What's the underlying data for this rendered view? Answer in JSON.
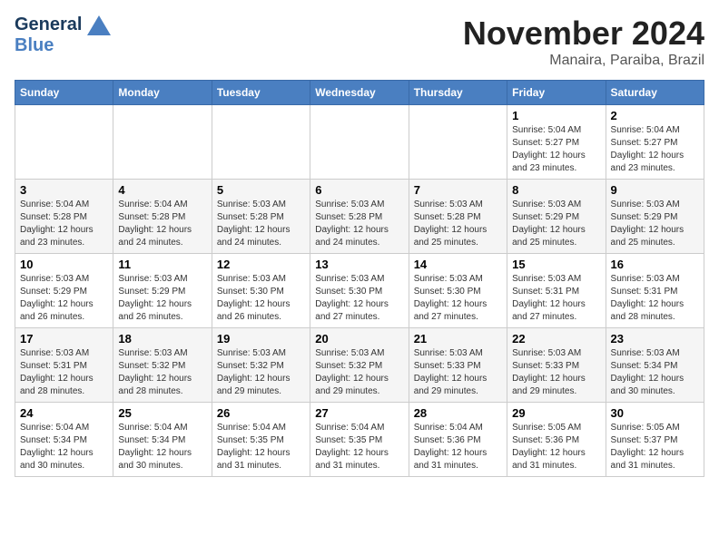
{
  "header": {
    "logo_line1": "General",
    "logo_line2": "Blue",
    "month_title": "November 2024",
    "location": "Manaira, Paraiba, Brazil"
  },
  "weekdays": [
    "Sunday",
    "Monday",
    "Tuesday",
    "Wednesday",
    "Thursday",
    "Friday",
    "Saturday"
  ],
  "weeks": [
    [
      {
        "day": "",
        "info": ""
      },
      {
        "day": "",
        "info": ""
      },
      {
        "day": "",
        "info": ""
      },
      {
        "day": "",
        "info": ""
      },
      {
        "day": "",
        "info": ""
      },
      {
        "day": "1",
        "info": "Sunrise: 5:04 AM\nSunset: 5:27 PM\nDaylight: 12 hours and 23 minutes."
      },
      {
        "day": "2",
        "info": "Sunrise: 5:04 AM\nSunset: 5:27 PM\nDaylight: 12 hours and 23 minutes."
      }
    ],
    [
      {
        "day": "3",
        "info": "Sunrise: 5:04 AM\nSunset: 5:28 PM\nDaylight: 12 hours and 23 minutes."
      },
      {
        "day": "4",
        "info": "Sunrise: 5:04 AM\nSunset: 5:28 PM\nDaylight: 12 hours and 24 minutes."
      },
      {
        "day": "5",
        "info": "Sunrise: 5:03 AM\nSunset: 5:28 PM\nDaylight: 12 hours and 24 minutes."
      },
      {
        "day": "6",
        "info": "Sunrise: 5:03 AM\nSunset: 5:28 PM\nDaylight: 12 hours and 24 minutes."
      },
      {
        "day": "7",
        "info": "Sunrise: 5:03 AM\nSunset: 5:28 PM\nDaylight: 12 hours and 25 minutes."
      },
      {
        "day": "8",
        "info": "Sunrise: 5:03 AM\nSunset: 5:29 PM\nDaylight: 12 hours and 25 minutes."
      },
      {
        "day": "9",
        "info": "Sunrise: 5:03 AM\nSunset: 5:29 PM\nDaylight: 12 hours and 25 minutes."
      }
    ],
    [
      {
        "day": "10",
        "info": "Sunrise: 5:03 AM\nSunset: 5:29 PM\nDaylight: 12 hours and 26 minutes."
      },
      {
        "day": "11",
        "info": "Sunrise: 5:03 AM\nSunset: 5:29 PM\nDaylight: 12 hours and 26 minutes."
      },
      {
        "day": "12",
        "info": "Sunrise: 5:03 AM\nSunset: 5:30 PM\nDaylight: 12 hours and 26 minutes."
      },
      {
        "day": "13",
        "info": "Sunrise: 5:03 AM\nSunset: 5:30 PM\nDaylight: 12 hours and 27 minutes."
      },
      {
        "day": "14",
        "info": "Sunrise: 5:03 AM\nSunset: 5:30 PM\nDaylight: 12 hours and 27 minutes."
      },
      {
        "day": "15",
        "info": "Sunrise: 5:03 AM\nSunset: 5:31 PM\nDaylight: 12 hours and 27 minutes."
      },
      {
        "day": "16",
        "info": "Sunrise: 5:03 AM\nSunset: 5:31 PM\nDaylight: 12 hours and 28 minutes."
      }
    ],
    [
      {
        "day": "17",
        "info": "Sunrise: 5:03 AM\nSunset: 5:31 PM\nDaylight: 12 hours and 28 minutes."
      },
      {
        "day": "18",
        "info": "Sunrise: 5:03 AM\nSunset: 5:32 PM\nDaylight: 12 hours and 28 minutes."
      },
      {
        "day": "19",
        "info": "Sunrise: 5:03 AM\nSunset: 5:32 PM\nDaylight: 12 hours and 29 minutes."
      },
      {
        "day": "20",
        "info": "Sunrise: 5:03 AM\nSunset: 5:32 PM\nDaylight: 12 hours and 29 minutes."
      },
      {
        "day": "21",
        "info": "Sunrise: 5:03 AM\nSunset: 5:33 PM\nDaylight: 12 hours and 29 minutes."
      },
      {
        "day": "22",
        "info": "Sunrise: 5:03 AM\nSunset: 5:33 PM\nDaylight: 12 hours and 29 minutes."
      },
      {
        "day": "23",
        "info": "Sunrise: 5:03 AM\nSunset: 5:34 PM\nDaylight: 12 hours and 30 minutes."
      }
    ],
    [
      {
        "day": "24",
        "info": "Sunrise: 5:04 AM\nSunset: 5:34 PM\nDaylight: 12 hours and 30 minutes."
      },
      {
        "day": "25",
        "info": "Sunrise: 5:04 AM\nSunset: 5:34 PM\nDaylight: 12 hours and 30 minutes."
      },
      {
        "day": "26",
        "info": "Sunrise: 5:04 AM\nSunset: 5:35 PM\nDaylight: 12 hours and 31 minutes."
      },
      {
        "day": "27",
        "info": "Sunrise: 5:04 AM\nSunset: 5:35 PM\nDaylight: 12 hours and 31 minutes."
      },
      {
        "day": "28",
        "info": "Sunrise: 5:04 AM\nSunset: 5:36 PM\nDaylight: 12 hours and 31 minutes."
      },
      {
        "day": "29",
        "info": "Sunrise: 5:05 AM\nSunset: 5:36 PM\nDaylight: 12 hours and 31 minutes."
      },
      {
        "day": "30",
        "info": "Sunrise: 5:05 AM\nSunset: 5:37 PM\nDaylight: 12 hours and 31 minutes."
      }
    ]
  ]
}
